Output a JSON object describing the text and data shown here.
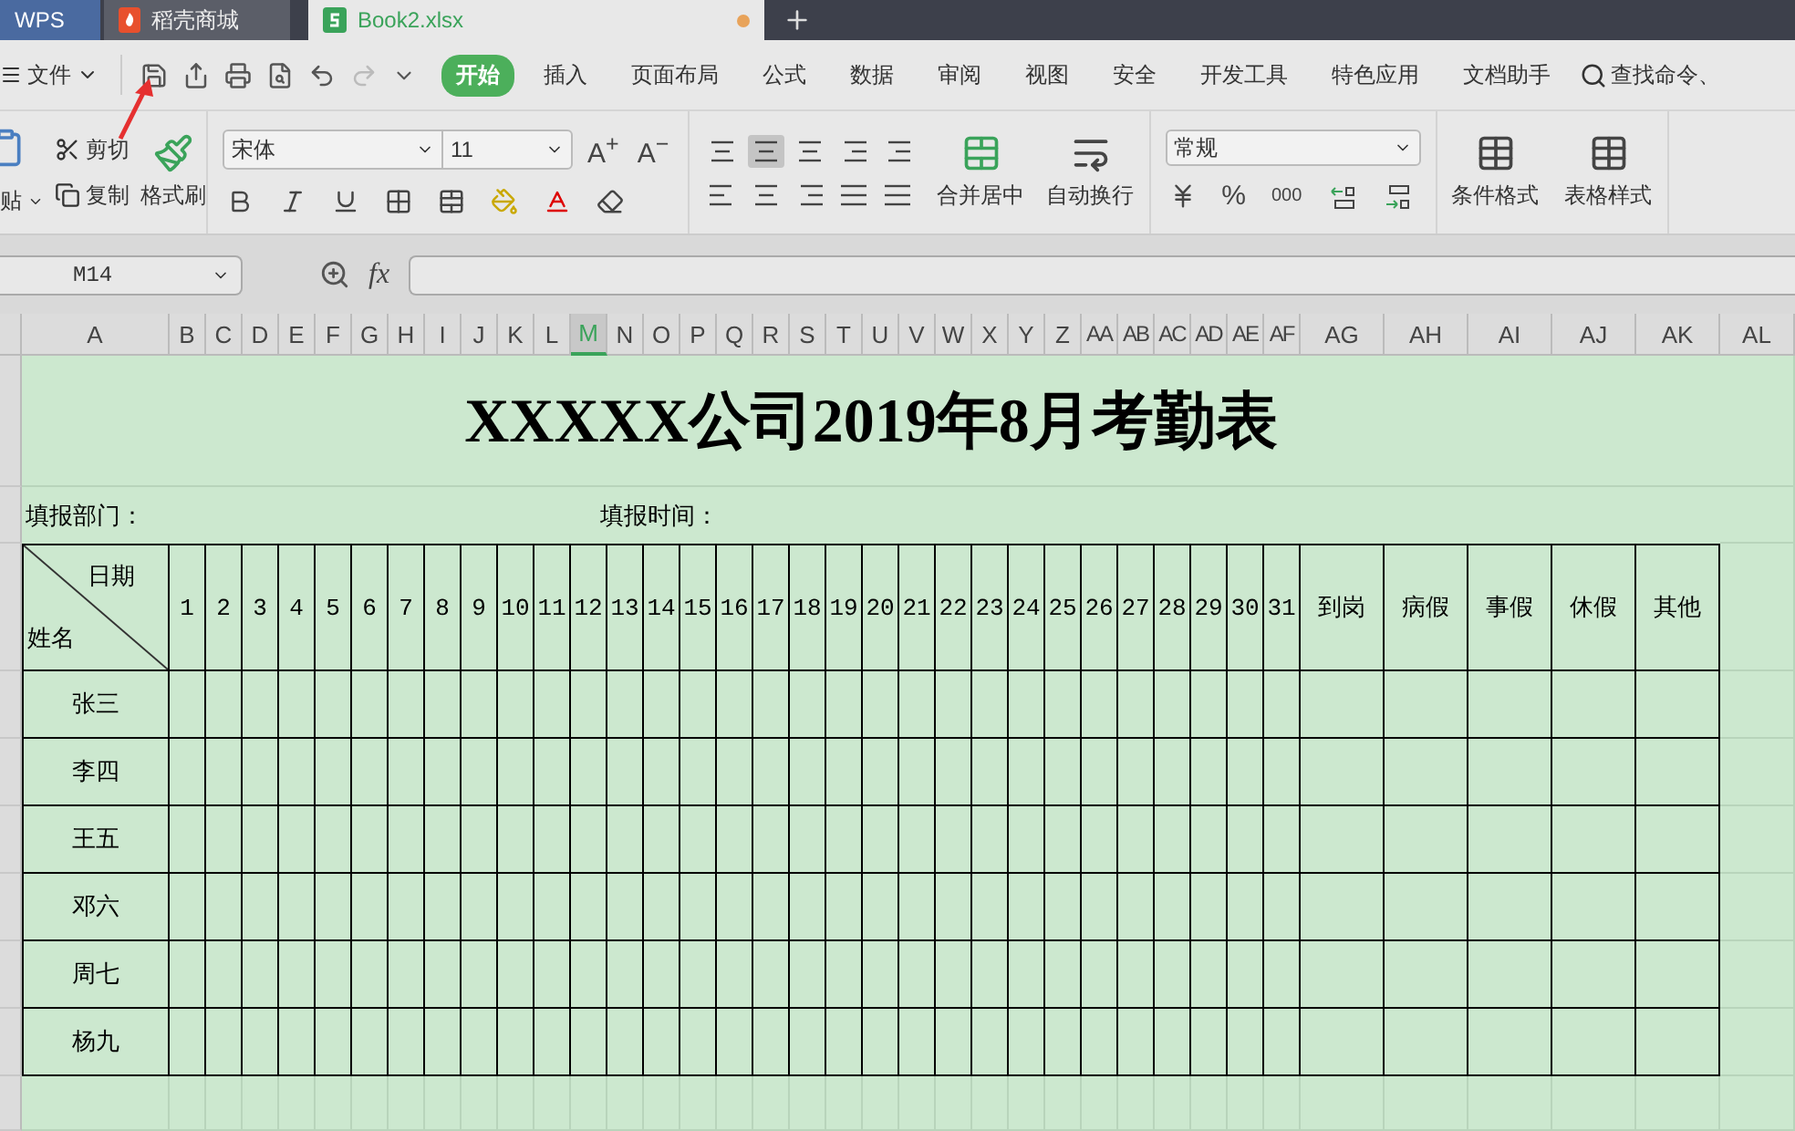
{
  "app_tabs": [
    {
      "kind": "brand",
      "label": "WPS",
      "selected": false
    },
    {
      "kind": "store",
      "label": "稻壳商城",
      "selected": false
    },
    {
      "kind": "sheet",
      "label": "Book2.xlsx",
      "selected": true,
      "unsaved": true
    }
  ],
  "file_menu": "文件",
  "menu_tabs": [
    {
      "label": "开始",
      "selected": true
    },
    {
      "label": "插入",
      "selected": false
    },
    {
      "label": "页面布局",
      "selected": false
    },
    {
      "label": "公式",
      "selected": false
    },
    {
      "label": "数据",
      "selected": false
    },
    {
      "label": "审阅",
      "selected": false
    },
    {
      "label": "视图",
      "selected": false
    },
    {
      "label": "安全",
      "selected": false
    },
    {
      "label": "开发工具",
      "selected": false
    },
    {
      "label": "特色应用",
      "selected": false
    },
    {
      "label": "文档助手",
      "selected": false
    }
  ],
  "search_command": "查找命令、",
  "ribbon": {
    "paste": "贴",
    "cut": "剪切",
    "copy": "复制",
    "format_painter": "格式刷",
    "font": "宋体",
    "font_size": "11",
    "grow_font": "A$^{+}$",
    "shrink_font": "A$^{−}$",
    "merge": "合并居中",
    "wrap": "自动换行",
    "number_format": "常规",
    "percent": "%",
    "thousands": "000",
    "cond_format": "条件格式",
    "table_style": "表格样式"
  },
  "name_box": "M14",
  "fx": "fx",
  "columns": [
    {
      "label": "A",
      "selected": false
    },
    {
      "label": "B",
      "selected": false
    },
    {
      "label": "C",
      "selected": false
    },
    {
      "label": "D",
      "selected": false
    },
    {
      "label": "E",
      "selected": false
    },
    {
      "label": "F",
      "selected": false
    },
    {
      "label": "G",
      "selected": false
    },
    {
      "label": "H",
      "selected": false
    },
    {
      "label": "I",
      "selected": false
    },
    {
      "label": "J",
      "selected": false
    },
    {
      "label": "K",
      "selected": false
    },
    {
      "label": "L",
      "selected": false
    },
    {
      "label": "M",
      "selected": true
    },
    {
      "label": "N",
      "selected": false
    },
    {
      "label": "O",
      "selected": false
    },
    {
      "label": "P",
      "selected": false
    },
    {
      "label": "Q",
      "selected": false
    },
    {
      "label": "R",
      "selected": false
    },
    {
      "label": "S",
      "selected": false
    },
    {
      "label": "T",
      "selected": false
    },
    {
      "label": "U",
      "selected": false
    },
    {
      "label": "V",
      "selected": false
    },
    {
      "label": "W",
      "selected": false
    },
    {
      "label": "X",
      "selected": false
    },
    {
      "label": "Y",
      "selected": false
    },
    {
      "label": "Z",
      "selected": false
    },
    {
      "label": "AA",
      "selected": false
    },
    {
      "label": "AB",
      "selected": false
    },
    {
      "label": "AC",
      "selected": false
    },
    {
      "label": "AD",
      "selected": false
    },
    {
      "label": "AE",
      "selected": false
    },
    {
      "label": "AF",
      "selected": false
    },
    {
      "label": "AG",
      "selected": false
    },
    {
      "label": "AH",
      "selected": false
    },
    {
      "label": "AI",
      "selected": false
    },
    {
      "label": "AJ",
      "selected": false
    },
    {
      "label": "AK",
      "selected": false
    },
    {
      "label": "AL",
      "selected": false
    }
  ],
  "sheet": {
    "title": "XXXXX公司2019年8月考勤表",
    "department": "填报部门：",
    "time": "填报时间：",
    "corner_top": "日期",
    "corner_bottom": "姓名",
    "days": [
      "1",
      "2",
      "3",
      "4",
      "5",
      "6",
      "7",
      "8",
      "9",
      "10",
      "11",
      "12",
      "13",
      "14",
      "15",
      "16",
      "17",
      "18",
      "19",
      "20",
      "21",
      "22",
      "23",
      "24",
      "25",
      "26",
      "27",
      "28",
      "29",
      "30",
      "31"
    ],
    "summary": [
      "到岗",
      "病假",
      "事假",
      "休假",
      "其他"
    ],
    "names": [
      "张三",
      "李四",
      "王五",
      "邓六",
      "周七",
      "杨九"
    ]
  }
}
